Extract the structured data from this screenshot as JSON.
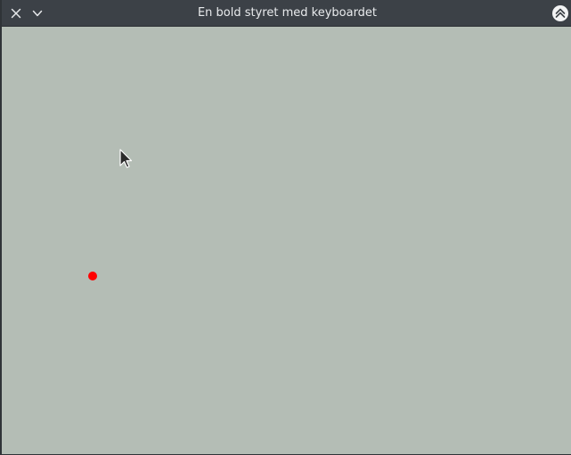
{
  "window": {
    "title": "En bold styret med keyboardet",
    "buttons": {
      "close_icon": "close-icon",
      "menu_icon": "chevron-down-icon",
      "keep_above_icon": "keep-above-icon"
    }
  },
  "scene": {
    "background_color": "#b4bdb5",
    "ball_color": "#ff0000"
  }
}
